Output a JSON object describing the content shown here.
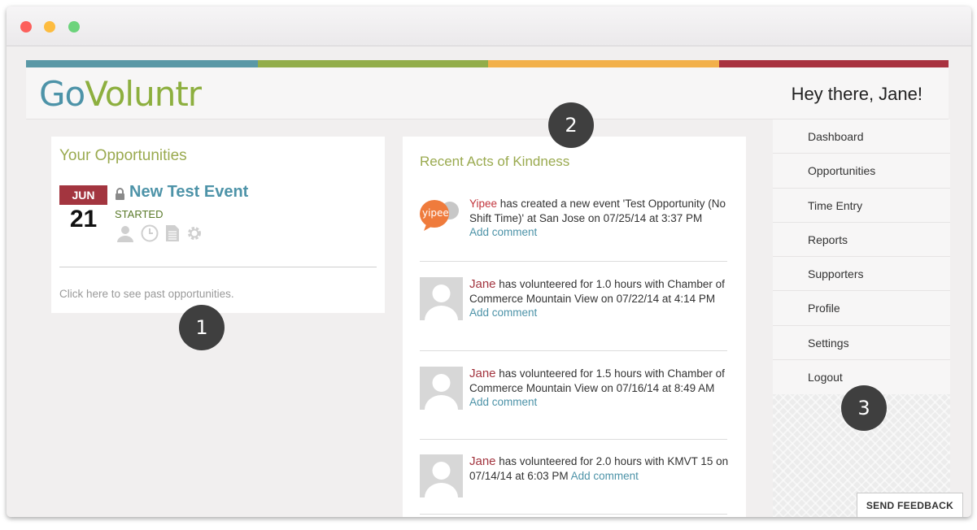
{
  "brand": {
    "logo_go": "Go",
    "logo_rest": "Voluntr",
    "greeting": "Hey there, Jane!"
  },
  "colors": {
    "teal": "#4d93a8",
    "green": "#8daf3f",
    "orange": "#f2b04a",
    "red": "#a3353f"
  },
  "markers": [
    "1",
    "2",
    "3"
  ],
  "opportunities": {
    "title": "Your Opportunities",
    "event": {
      "month": "JUN",
      "day": "21",
      "name": "New Test Event",
      "status": "STARTED",
      "icons": [
        "lock-icon",
        "person-icon",
        "clock-icon",
        "document-icon",
        "gear-icon"
      ]
    },
    "past_link": "Click here to see past opportunities."
  },
  "feed": {
    "title": "Recent Acts of Kindness",
    "items": [
      {
        "name": "Yipee",
        "text_before": " has created a new event 'Test Opportunity (No Shift Time)' at San Jose on 07/25/14 at 3:37 PM",
        "link": "Add comment",
        "avatar": "yipee-logo",
        "avatar_text": "yipee"
      },
      {
        "name": "Jane",
        "text_before": "  has volunteered for 1.0 hours with Chamber of Commerce Mountain View on 07/22/14 at 4:14 PM ",
        "link": "Add comment",
        "avatar": "default-user-avatar"
      },
      {
        "name": "Jane",
        "text_before": "  has volunteered for 1.5 hours with Chamber of Commerce Mountain View on 07/16/14 at 8:49 AM ",
        "link": "Add comment",
        "avatar": "default-user-avatar"
      },
      {
        "name": "Jane",
        "text_before": " has volunteered for 2.0 hours with KMVT 15 on 07/14/14 at 6:03 PM ",
        "link": "Add comment",
        "avatar": "default-user-avatar"
      }
    ]
  },
  "sidebar": {
    "items": [
      {
        "label": "Dashboard"
      },
      {
        "label": "Opportunities"
      },
      {
        "label": "Time Entry"
      },
      {
        "label": "Reports"
      },
      {
        "label": "Supporters"
      },
      {
        "label": "Profile"
      },
      {
        "label": "Settings"
      },
      {
        "label": "Logout"
      }
    ]
  },
  "feedback_label": "SEND FEEDBACK"
}
